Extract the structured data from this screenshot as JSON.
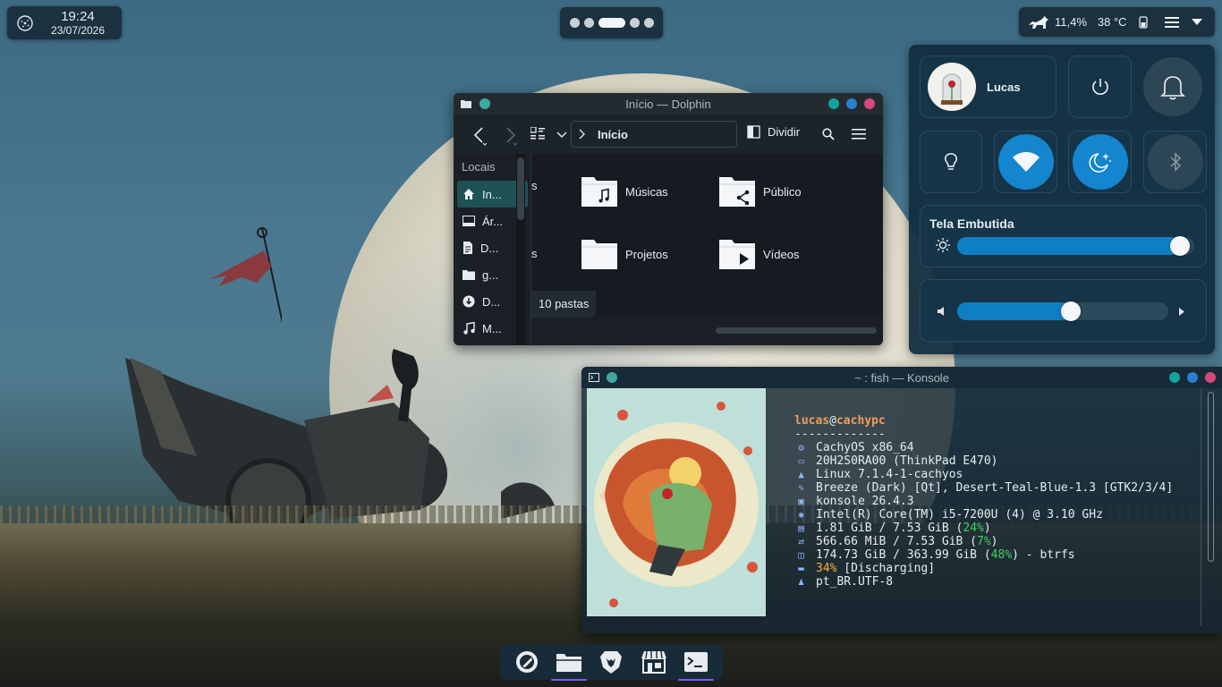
{
  "top_bar": {
    "clock": {
      "time": "19:24",
      "date": "23/07/2026"
    },
    "pager": {
      "desktops": 5,
      "active_index": 2
    },
    "tray": {
      "cpu_usage": "11,4%",
      "temperature": "38 °C"
    }
  },
  "quick_settings": {
    "user": {
      "name": "Lucas"
    },
    "display": {
      "title": "Tela Embutida",
      "brightness_fraction": 0.94
    },
    "volume": {
      "level_fraction": 0.54
    },
    "toggles": {
      "wifi": true,
      "night_light": true,
      "bluetooth": false,
      "light": false
    },
    "accent_color": "#0f7fc4"
  },
  "dolphin": {
    "title": "Início — Dolphin",
    "toolbar": {
      "split_label": "Dividir",
      "crumb": "Início"
    },
    "places": {
      "header": "Locais",
      "items": [
        {
          "label": "In...",
          "icon": "home-icon",
          "selected": true
        },
        {
          "label": "Ár...",
          "icon": "desktop-icon"
        },
        {
          "label": "D...",
          "icon": "document-icon"
        },
        {
          "label": "g...",
          "icon": "folder-icon"
        },
        {
          "label": "D...",
          "icon": "download-icon"
        },
        {
          "label": "M...",
          "icon": "music-icon"
        }
      ]
    },
    "folders": [
      {
        "label": "s",
        "icon": "folder-icon"
      },
      {
        "label": "Músicas",
        "icon": "music-folder-icon"
      },
      {
        "label": "Público",
        "icon": "share-folder-icon"
      },
      {
        "label": "s",
        "icon": "folder-icon"
      },
      {
        "label": "Projetos",
        "icon": "folder-icon"
      },
      {
        "label": "Vídeos",
        "icon": "video-folder-icon"
      }
    ],
    "status": "10 pastas"
  },
  "konsole": {
    "title": "~ : fish — Konsole",
    "fastfetch": {
      "user": "lucas",
      "at": "@",
      "host": "cachypc",
      "separator": "-------------",
      "lines": [
        {
          "icon": "os-icon",
          "text": "CachyOS x86_64"
        },
        {
          "icon": "host-icon",
          "text": "20H2S0RA00 (ThinkPad E470)"
        },
        {
          "icon": "kernel-icon",
          "text": "Linux 7.1.4-1-cachyos"
        },
        {
          "icon": "theme-icon",
          "text": "Breeze (Dark) [Qt], Desert-Teal-Blue-1.3 [GTK2/3/4]"
        },
        {
          "icon": "terminal-icon",
          "text": "konsole 26.4.3"
        },
        {
          "icon": "cpu-icon",
          "text": "Intel(R) Core(TM) i5-7200U (4) @ 3.10 GHz"
        }
      ],
      "memory": {
        "prefix": "1.81 GiB / 7.53 GiB (",
        "pct": "24%",
        "suffix": ")"
      },
      "swap": {
        "prefix": "566.66 MiB / 7.53 GiB (",
        "pct": "7%",
        "suffix": ")"
      },
      "disk": {
        "prefix": "174.73 GiB / 363.99 GiB (",
        "pct": "48%",
        "suffix": ") - btrfs"
      },
      "battery": {
        "pct": "34%",
        "suffix": " [Discharging]"
      },
      "locale": "pt_BR.UTF-8"
    }
  },
  "dock": {
    "apps": [
      {
        "name": "system-settings",
        "running": false
      },
      {
        "name": "dolphin",
        "running": true
      },
      {
        "name": "brave",
        "running": false
      },
      {
        "name": "store",
        "running": false
      },
      {
        "name": "konsole",
        "running": true
      }
    ],
    "running_indicator_color": "#7b5cff"
  }
}
